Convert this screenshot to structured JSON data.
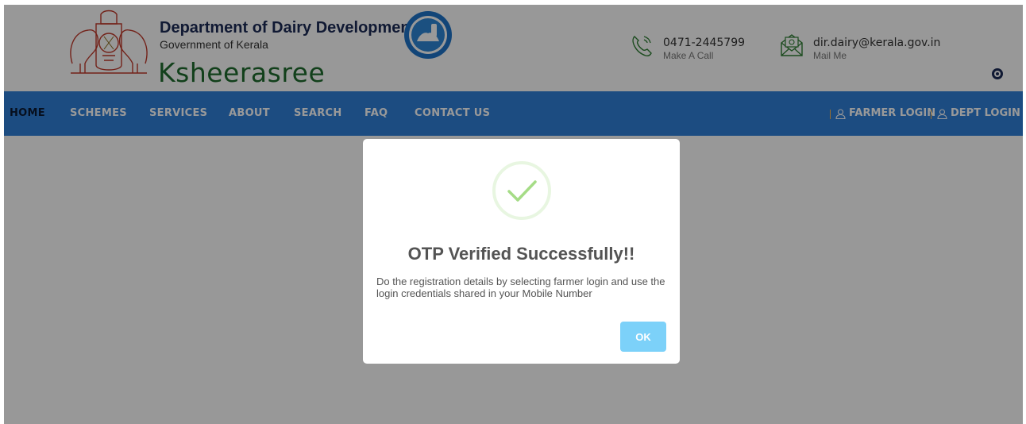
{
  "header": {
    "dept_title": "Department of Dairy Development",
    "dept_subtitle": "Government of Kerala",
    "brand": "Ksheerasree",
    "phone": {
      "number": "0471-2445799",
      "label": "Make A Call"
    },
    "mail": {
      "address": "dir.dairy@kerala.gov.in",
      "label": "Mail Me"
    }
  },
  "nav": {
    "items": [
      "HOME",
      "SCHEMES",
      "SERVICES",
      "ABOUT",
      "SEARCH",
      "FAQ",
      "CONTACT US"
    ],
    "active": "HOME",
    "farmer_login": "FARMER LOGIN",
    "dept_login": "DEPT LOGIN"
  },
  "modal": {
    "title": "OTP Verified Successfully!!",
    "message": "Do the registration details by selecting farmer login and use the login credentials shared in your Mobile Number",
    "ok_label": "OK"
  },
  "colors": {
    "nav_bg": "#2f7fd8",
    "brand_green": "#1f6b2e",
    "success_green": "#a5dc86",
    "ok_button": "#7cd1f9"
  }
}
